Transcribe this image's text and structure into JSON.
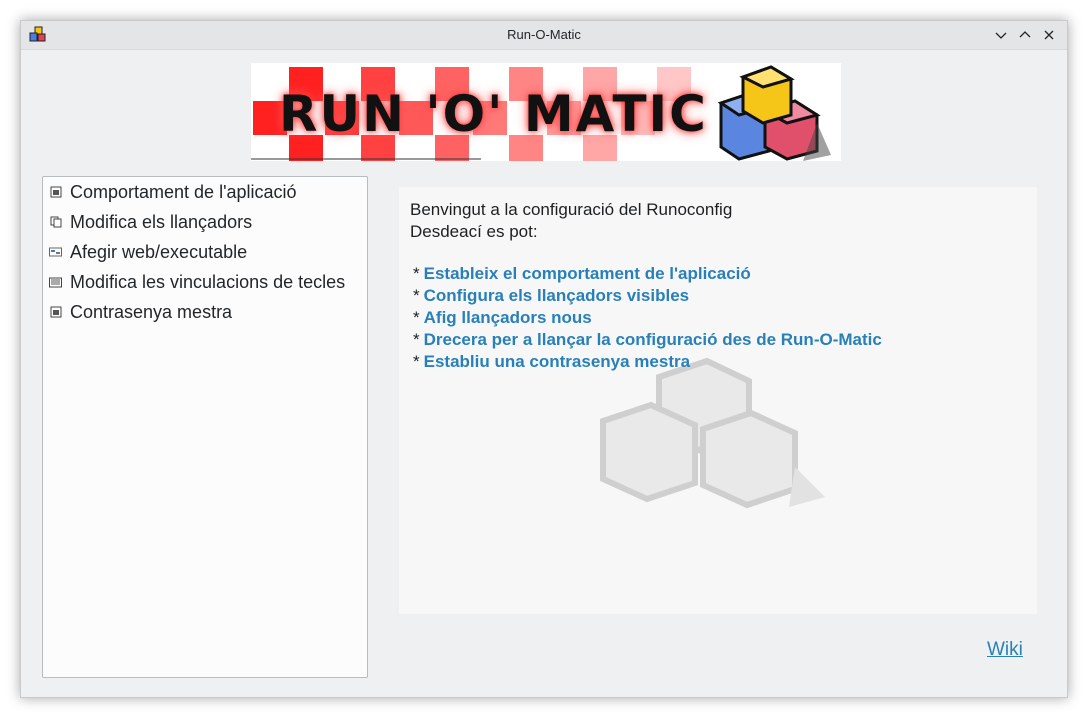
{
  "window": {
    "title": "Run-O-Matic",
    "controls": [
      "minimize-icon",
      "maximize-icon",
      "close-icon"
    ]
  },
  "banner": {
    "text": "RUN 'O' MATIC",
    "colors": {
      "checker": "#ff2020",
      "glow": "#ff3030"
    }
  },
  "sidebar": {
    "items": [
      {
        "label": "Comportament de l'aplicació",
        "icon": "window-icon"
      },
      {
        "label": "Modifica els llançadors",
        "icon": "copy-icon"
      },
      {
        "label": "Afegir web/executable",
        "icon": "web-exec-icon"
      },
      {
        "label": "Modifica les vinculacions de tecles",
        "icon": "keyboard-icon"
      },
      {
        "label": "Contrasenya mestra",
        "icon": "window-icon"
      }
    ]
  },
  "content": {
    "intro_line1": "Benvingut a la configuració del Runoconfig",
    "intro_line2": "Desdeací es pot:",
    "bullet": "*",
    "links": [
      "Estableix el comportament de l'aplicació",
      "Configura els llançadors visibles",
      "Afig llançadors nous",
      "Drecera per a llançar la configuració des de Run-O-Matic",
      "Establiu una contrasenya mestra"
    ]
  },
  "footer": {
    "wiki": "Wiki"
  },
  "colors": {
    "link": "#2980b9",
    "window_bg": "#eff0f1",
    "titlebar": "#e3e5e7"
  }
}
